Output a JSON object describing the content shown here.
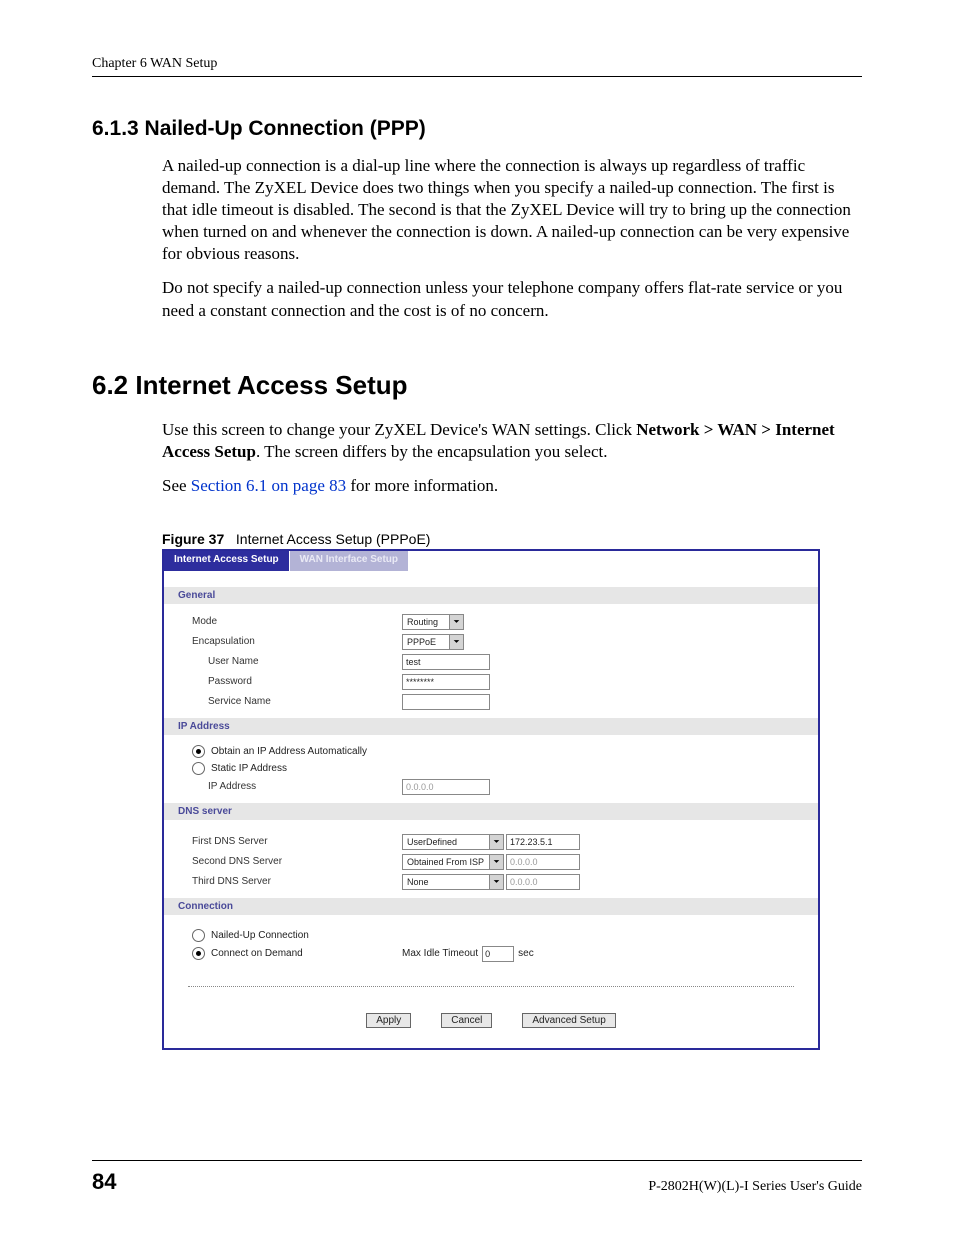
{
  "header": {
    "chapter": "Chapter 6 WAN Setup"
  },
  "section613": {
    "heading": "6.1.3  Nailed-Up Connection (PPP)",
    "para1": "A nailed-up connection is a dial-up line where the connection is always up regardless of traffic demand. The ZyXEL Device does two things when you specify a nailed-up connection. The first is that idle timeout is disabled. The second is that the ZyXEL Device will try to bring up the connection when turned on and whenever the connection is down. A nailed-up connection can be very expensive for obvious reasons.",
    "para2": "Do not specify a nailed-up connection unless your telephone company offers flat-rate service or you need a constant connection and the cost is of no concern."
  },
  "section62": {
    "heading": "6.2  Internet Access Setup",
    "para1_a": "Use this screen to change your ZyXEL Device's WAN settings. Click ",
    "para1_bold": "Network > WAN > Internet Access Setup",
    "para1_c": ". The screen differs by the encapsulation you select.",
    "para2_a": "See ",
    "para2_link": "Section 6.1 on page 83",
    "para2_b": " for more information."
  },
  "figure": {
    "label": "Figure 37",
    "caption": "Internet Access Setup (PPPoE)"
  },
  "ui": {
    "tabs": {
      "active": "Internet Access Setup",
      "inactive": "WAN Interface Setup"
    },
    "general": {
      "header": "General",
      "mode_label": "Mode",
      "mode_value": "Routing",
      "encap_label": "Encapsulation",
      "encap_value": "PPPoE",
      "user_label": "User Name",
      "user_value": "test",
      "pass_label": "Password",
      "pass_value": "********",
      "service_label": "Service Name",
      "service_value": ""
    },
    "ip": {
      "header": "IP Address",
      "opt_auto": "Obtain an IP Address Automatically",
      "opt_static": "Static IP Address",
      "ip_label": "IP Address",
      "ip_value": "0.0.0.0"
    },
    "dns": {
      "header": "DNS server",
      "first_label": "First DNS Server",
      "first_sel": "UserDefined",
      "first_val": "172.23.5.1",
      "second_label": "Second DNS Server",
      "second_sel": "Obtained From ISP",
      "second_val": "0.0.0.0",
      "third_label": "Third DNS Server",
      "third_sel": "None",
      "third_val": "0.0.0.0"
    },
    "conn": {
      "header": "Connection",
      "opt_nailed": "Nailed-Up Connection",
      "opt_demand": "Connect on Demand",
      "idle_label": "Max Idle Timeout",
      "idle_value": "0",
      "idle_unit": "sec"
    },
    "buttons": {
      "apply": "Apply",
      "cancel": "Cancel",
      "advanced": "Advanced Setup"
    }
  },
  "footer": {
    "page": "84",
    "guide": "P-2802H(W)(L)-I Series User's Guide"
  }
}
